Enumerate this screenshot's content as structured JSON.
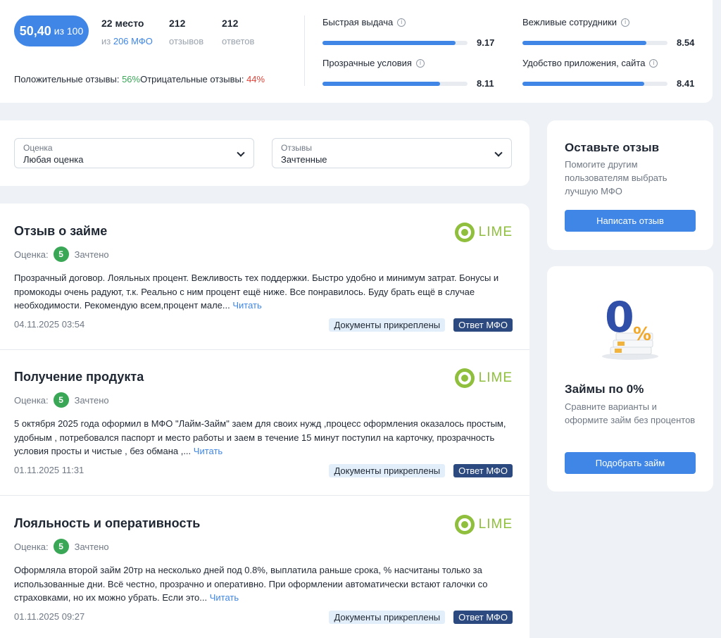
{
  "summary": {
    "score": "50,40",
    "score_of": "из 100",
    "place": "22 место",
    "place_sub_prefix": "из ",
    "place_sub_link": "206 МФО",
    "reviews_count": "212",
    "reviews_label": "отзывов",
    "answers_count": "212",
    "answers_label": "ответов",
    "positive_label": "Положительные отзывы: ",
    "positive_value": "56%",
    "negative_label": "Отрицательные отзывы: ",
    "negative_value": "44%",
    "metrics": [
      {
        "label": "Быстрая выдача",
        "value": "9.17",
        "fraction": 0.917
      },
      {
        "label": "Вежливые сотрудники",
        "value": "8.54",
        "fraction": 0.854
      },
      {
        "label": "Прозрачные условия",
        "value": "8.11",
        "fraction": 0.811
      },
      {
        "label": "Удобство приложения, сайта",
        "value": "8.41",
        "fraction": 0.841
      }
    ]
  },
  "filters": {
    "rating": {
      "caption": "Оценка",
      "value": "Любая оценка"
    },
    "reviews": {
      "caption": "Отзывы",
      "value": "Зачтенные"
    }
  },
  "brand_logo_text": "LIME",
  "reviews": [
    {
      "title": "Отзыв о займе",
      "rating_label": "Оценка:",
      "rating": "5",
      "status": "Зачтено",
      "text": "Прозрачный договор. Лояльных процент. Вежливость тех поддержки. Быстро удобно и минимум затрат. Бонусы и промокоды очень радуют, т.к. Реально с ним процент ещё ниже. Все понравилось. Буду брать ещё в случае необходимости. Рекомендую всем,процент мале...",
      "read_more": "Читать",
      "date": "04.11.2025 03:54",
      "tag_docs": "Документы прикреплены",
      "tag_answer": "Ответ МФО"
    },
    {
      "title": "Получение продукта",
      "rating_label": "Оценка:",
      "rating": "5",
      "status": "Зачтено",
      "text": "5 октября 2025 года оформил в МФО \"Лайм-Займ\" заем для своих нужд ,процесс оформления оказалось простым, удобным , потребовался паспорт и место работы и заем в течение 15 минут поступил на карточку, прозрачность условия просты и чистые , без обмана ,...",
      "read_more": "Читать",
      "date": "01.11.2025 11:31",
      "tag_docs": "Документы прикреплены",
      "tag_answer": "Ответ МФО"
    },
    {
      "title": "Лояльность и оперативность",
      "rating_label": "Оценка:",
      "rating": "5",
      "status": "Зачтено",
      "text": "Оформляла второй займ 20тр на несколько дней под 0.8%, выплатила раньше срока, % насчитаны только за использованные дни. Всё честно, прозрачно и оперативно. При оформлении автоматически встают галочки со страховками, но их можно убрать. Если это...",
      "read_more": "Читать",
      "date": "01.11.2025 09:27",
      "tag_docs": "Документы прикреплены",
      "tag_answer": "Ответ МФО"
    }
  ],
  "side_review": {
    "title": "Оставьте отзыв",
    "text": "Помогите другим пользователям выбрать лучшую МФО",
    "button": "Написать отзыв"
  },
  "side_zero": {
    "illustration_text": "0%",
    "title": "Займы по 0%",
    "text": "Сравните варианты и оформите займ без процентов",
    "button": "Подобрать займ"
  },
  "colors": {
    "accent": "#3f86e6",
    "positive": "#3aa757",
    "negative": "#e0453a",
    "lime": "#8fbf3d",
    "answer_tag": "#2c4a7f"
  }
}
